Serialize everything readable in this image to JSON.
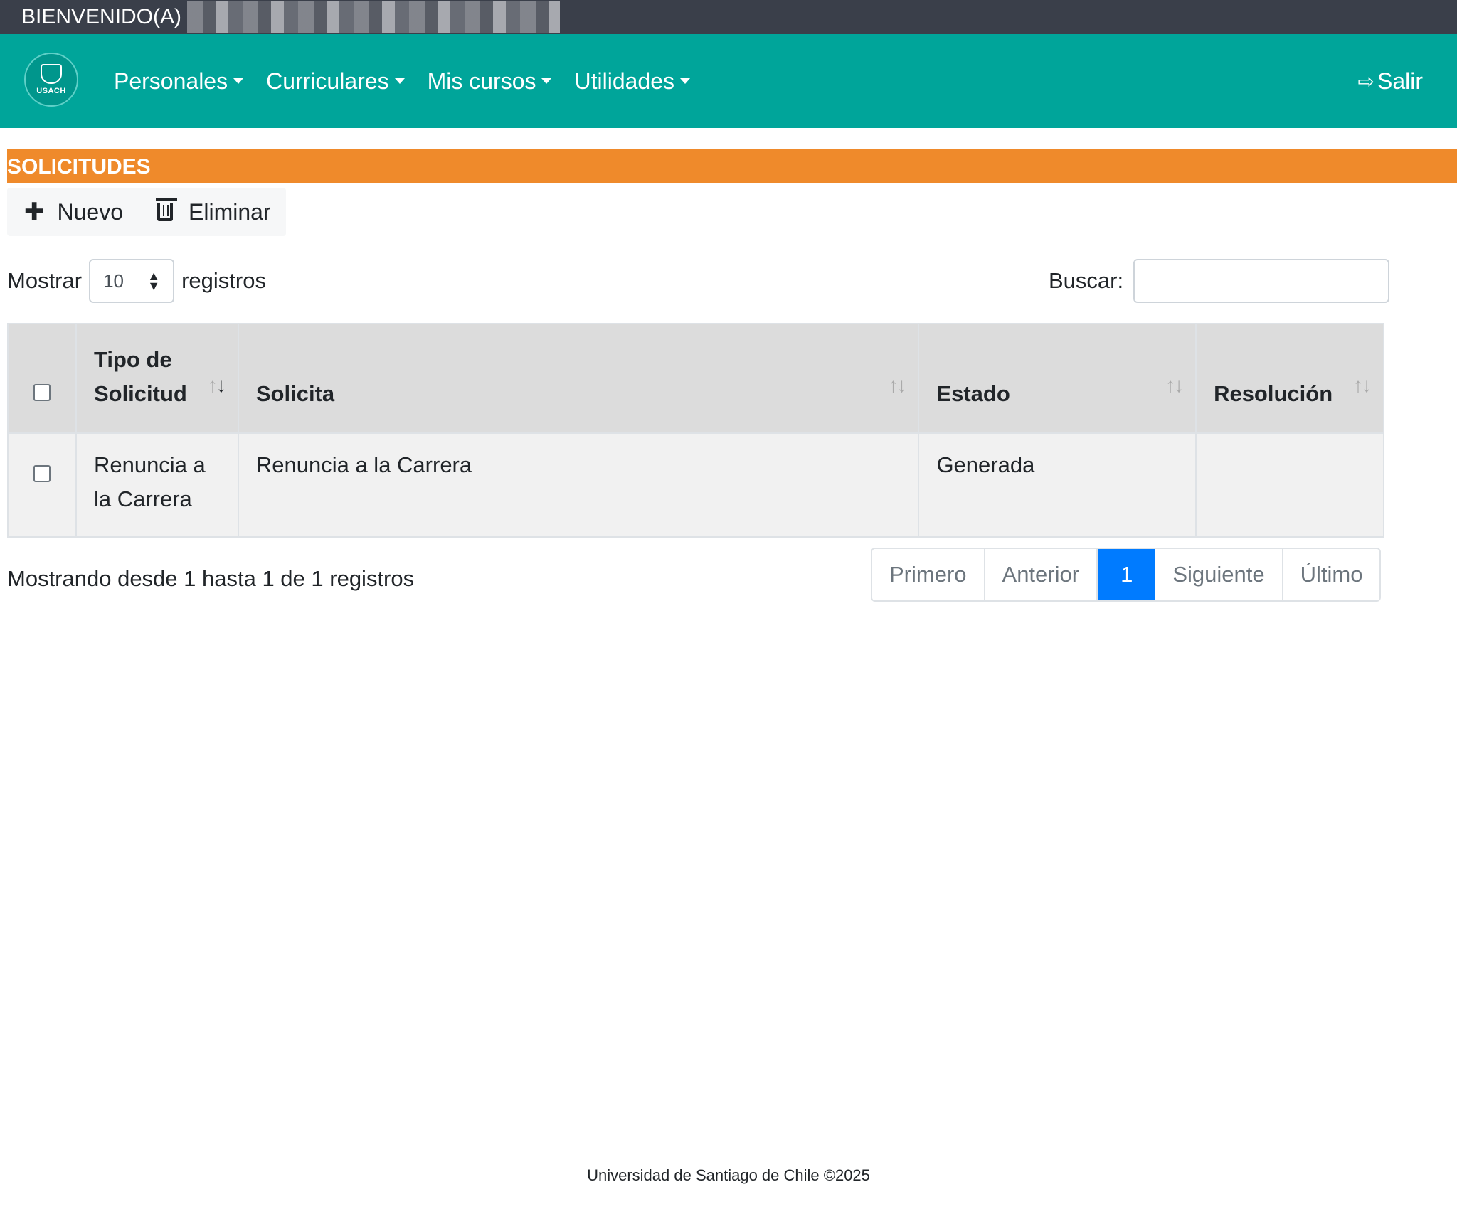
{
  "topbar": {
    "welcome": "BIENVENIDO(A)"
  },
  "navbar": {
    "logo_text": "USACH",
    "menu": [
      {
        "label": "Personales"
      },
      {
        "label": "Curriculares"
      },
      {
        "label": "Mis cursos"
      },
      {
        "label": "Utilidades"
      }
    ],
    "logout_label": "Salir"
  },
  "section": {
    "title": "SOLICITUDES"
  },
  "toolbar": {
    "new_label": "Nuevo",
    "delete_label": "Eliminar"
  },
  "length": {
    "prefix": "Mostrar",
    "value": "10",
    "suffix": "registros"
  },
  "search": {
    "label": "Buscar:",
    "value": ""
  },
  "table": {
    "headers": {
      "tipo_line1": "Tipo de",
      "tipo_line2": "Solicitud",
      "solicita": "Solicita",
      "estado": "Estado",
      "resolucion": "Resolución"
    },
    "rows": [
      {
        "tipo": "Renuncia a la Carrera",
        "solicita": "Renuncia a la Carrera",
        "estado": "Generada",
        "resolucion": ""
      }
    ]
  },
  "info": {
    "text": "Mostrando desde 1 hasta 1 de 1 registros"
  },
  "pagination": {
    "first": "Primero",
    "previous": "Anterior",
    "current": "1",
    "next": "Siguiente",
    "last": "Último"
  },
  "footer": {
    "text": "Universidad de Santiago de Chile ©2025"
  },
  "colors": {
    "topbar": "#3a3f4a",
    "navbar": "#00a59a",
    "section_header": "#ef8a2b",
    "active_page": "#007bff"
  }
}
